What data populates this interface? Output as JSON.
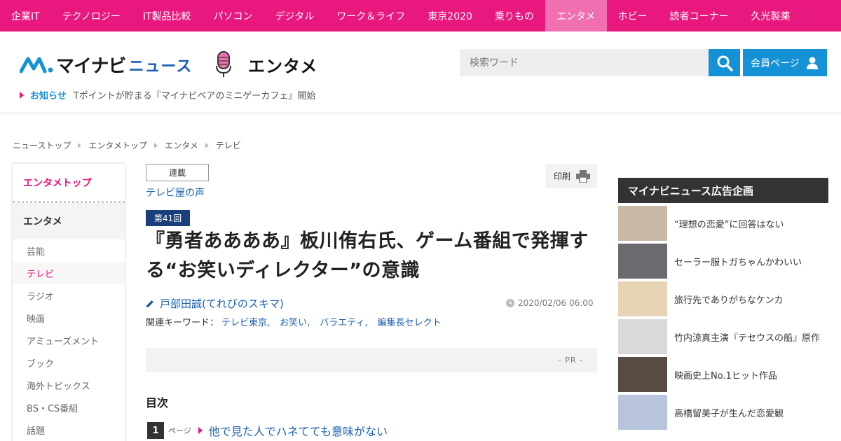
{
  "topnav": [
    "企業IT",
    "テクノロジー",
    "IT製品比較",
    "パソコン",
    "デジタル",
    "ワーク＆ライフ",
    "東京2020",
    "乗りもの",
    "エンタメ",
    "ホビー",
    "読者コーナー",
    "久光製薬"
  ],
  "topnav_active": "エンタメ",
  "header": {
    "logo_text": "マイナビ",
    "logo_sub": "ニュース",
    "section_title": "エンタメ",
    "search_placeholder": "検索ワード",
    "member_label": "会員ページ"
  },
  "notice": {
    "label": "お知らせ",
    "text": "Tポイントが貯まる『マイナビベアのミニゲーカフェ』開始"
  },
  "breadcrumb": [
    "ニューストップ",
    "エンタメトップ",
    "エンタメ",
    "テレビ"
  ],
  "sidebar": {
    "top": "エンタメトップ",
    "section": "エンタメ",
    "items": [
      "芸能",
      "テレビ",
      "ラジオ",
      "映画",
      "アミューズメント",
      "ブック",
      "海外トピックス",
      "BS・CS番組",
      "話題"
    ],
    "active": "テレビ"
  },
  "article": {
    "series_tag": "連載",
    "series_name": "テレビ屋の声",
    "print_label": "印刷",
    "episode": "第41回",
    "title": "『勇者ああああ』板川侑右氏、ゲーム番組で発揮する“お笑いディレクター”の意識",
    "author": "戸部田誠(てれびのスキマ)",
    "date": "2020/02/06 06:00",
    "keywords_label": "関連キーワード：",
    "keywords": [
      "テレビ東京,",
      "お笑い,",
      "バラエティ,",
      "編集長セレクト"
    ],
    "pr": "- PR -",
    "toc_heading": "目次",
    "toc": [
      {
        "num": "1",
        "page": "ページ",
        "title": "他で見た人でハネてても意味がない"
      }
    ]
  },
  "ads": {
    "header": "マイナビニュース広告企画",
    "items": [
      {
        "title": "“理想の恋愛”に回答はない",
        "thumb_color": "#c9b8a6"
      },
      {
        "title": "セーラー服トガちゃんかわいい",
        "thumb_color": "#6b6a70"
      },
      {
        "title": "旅行先でありがちなケンカ",
        "thumb_color": "#e9d3b5"
      },
      {
        "title": "竹内涼真主演『テセウスの船』原作",
        "thumb_color": "#d9d9d9"
      },
      {
        "title": "映画史上No.1ヒット作品",
        "thumb_color": "#5a4a44"
      },
      {
        "title": "高橋留美子が生んだ恋愛観",
        "thumb_color": "#b7c4dc"
      }
    ]
  },
  "colors": {
    "brand_pink": "#e8187f",
    "brand_blue": "#1592d6",
    "link_blue": "#1a5fb0",
    "navy": "#1a3f7a"
  }
}
